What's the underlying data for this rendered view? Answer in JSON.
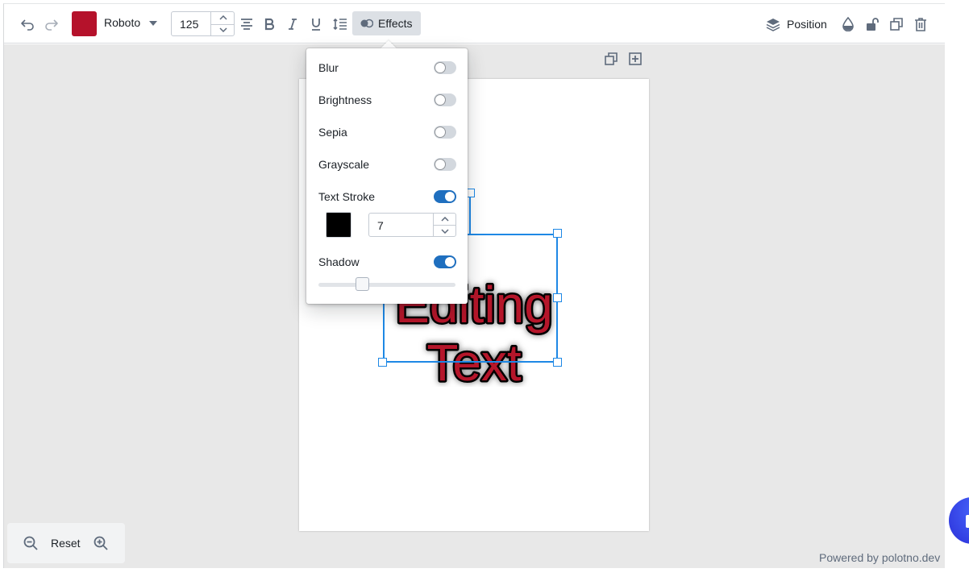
{
  "toolbar": {
    "text_color": "#b5122b",
    "font_family_label": "Roboto",
    "font_size": "125",
    "effects_label": "Effects",
    "position_label": "Position"
  },
  "canvas": {
    "text_content_line1": "Editing",
    "text_content_line2": "Text",
    "text_fill": "#b5122b",
    "text_stroke": "#000000",
    "selection_color": "#1e88e5"
  },
  "effects_panel": {
    "blur_label": "Blur",
    "blur_enabled": false,
    "brightness_label": "Brightness",
    "brightness_enabled": false,
    "sepia_label": "Sepia",
    "sepia_enabled": false,
    "grayscale_label": "Grayscale",
    "grayscale_enabled": false,
    "text_stroke_label": "Text Stroke",
    "text_stroke_enabled": true,
    "stroke_color": "#000000",
    "stroke_width": "7",
    "shadow_label": "Shadow",
    "shadow_enabled": true,
    "shadow_level": 0.32
  },
  "zoom": {
    "reset_label": "Reset"
  },
  "footer": {
    "powered_by": "Powered by polotno.dev"
  },
  "accent_colors": {
    "switch_on": "#1f6fbf",
    "chat_bubble": "#2a2fd8"
  }
}
